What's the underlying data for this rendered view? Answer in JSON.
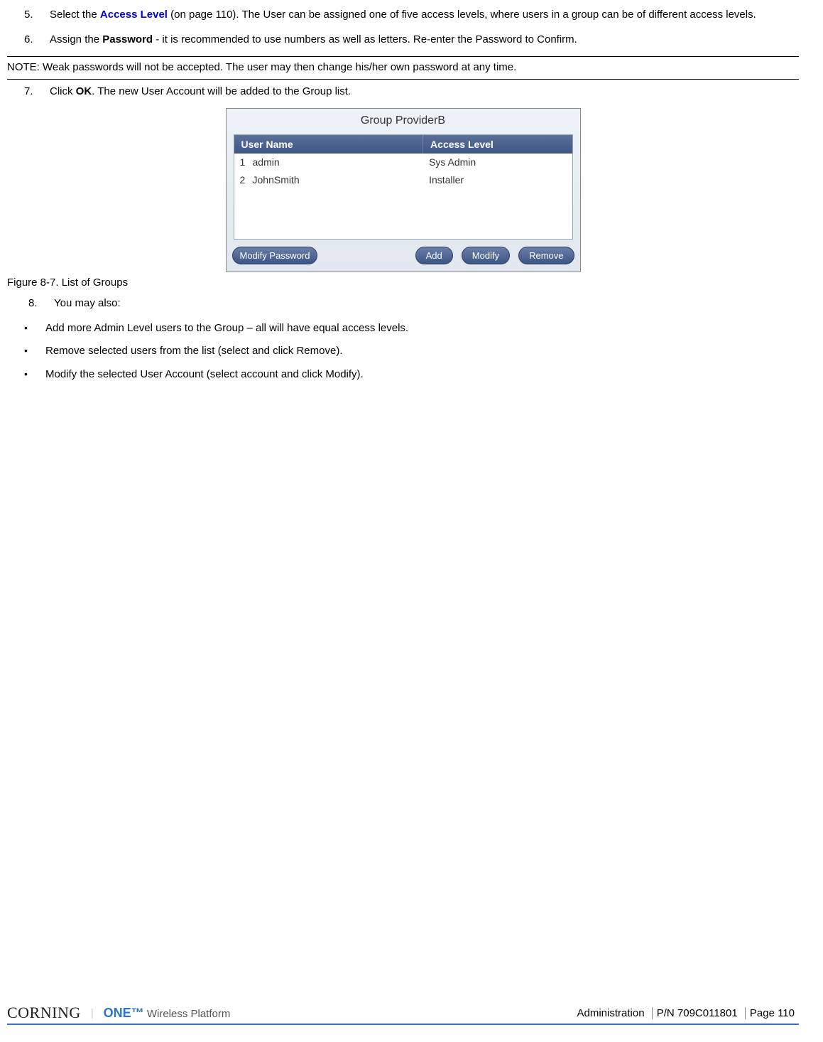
{
  "steps": {
    "s5_num": "5.",
    "s5_a": "Select the ",
    "s5_link": "Access Level",
    "s5_b": " (on page 110). The User can be assigned one of five access levels, where users in a group can be of different access levels.",
    "s6_num": "6.",
    "s6_a": "Assign the ",
    "s6_bold": "Password",
    "s6_b": " - it is recommended to use numbers as well as letters. Re-enter the Password to Confirm.",
    "note": "NOTE: Weak passwords will not be accepted. The user may then change his/her own password at any time.",
    "s7_num": "7.",
    "s7_a": "Click ",
    "s7_bold": "OK",
    "s7_b": ". The new User Account will be added to the Group list.",
    "s8_num": "8.",
    "s8_txt": "You may also:"
  },
  "dialog": {
    "title": "Group ProviderB",
    "col_user": "User Name",
    "col_level": "Access Level",
    "rows": [
      {
        "idx": "1",
        "user": "admin",
        "level": "Sys Admin"
      },
      {
        "idx": "2",
        "user": "JohnSmith",
        "level": "Installer"
      }
    ],
    "btn_modify_pw": "Modify Password",
    "btn_add": "Add",
    "btn_modify": "Modify",
    "btn_remove": "Remove"
  },
  "caption": "Figure 8-7. List of Groups",
  "bullets": {
    "b1": "Add more Admin Level users to the Group – all will have equal access levels.",
    "b2": "Remove selected users from the list (select and click Remove).",
    "b3": "Modify the selected User Account (select account and click Modify)."
  },
  "footer": {
    "corning": "CORNING",
    "one": "ONE™",
    "wp": "Wireless Platform",
    "section": "Administration",
    "pn": "P/N 709C011801",
    "page": "Page 110"
  }
}
